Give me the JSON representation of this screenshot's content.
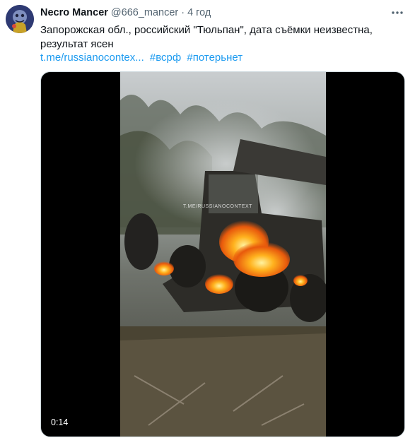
{
  "tweet": {
    "name": "Necro Mancer",
    "handle": "@666_mancer",
    "separator": "·",
    "time": "4 год",
    "more_icon": "more-horizontal-icon",
    "text": "Запорожская обл., российский \"Тюльпан\", дата съёмки неизвестна, результат ясен",
    "link_url": "t.me/russianocontex...",
    "hashtags": [
      "#всрф",
      "#потерьнет"
    ],
    "accent_color": "#1d9bf0"
  },
  "media": {
    "watermark": "T.ME/RUSSIANOCONTEXT",
    "duration": "0:14"
  }
}
